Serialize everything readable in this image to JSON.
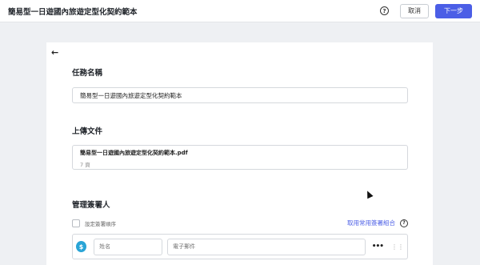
{
  "topbar": {
    "title": "簡易型一日遊國內旅遊定型化契約範本",
    "help_icon": "?",
    "cancel_label": "取消",
    "next_label": "下一步"
  },
  "content": {
    "back_icon": "←",
    "task_section_title": "任務名稱",
    "task_name_value": "簡易型一日遊國內旅遊定型化契約範本",
    "upload_section_title": "上傳文件",
    "file_name": "簡易型一日遊國內旅遊定型化契約範本.pdf",
    "file_pages": "7 頁",
    "signers_section_title": "管理簽署人",
    "order_checkbox_label": "設定簽署順序",
    "combo_link": "取用常用簽署組合",
    "combo_help_icon": "?",
    "signer": {
      "icon": "$",
      "name_placeholder": "姓名",
      "email_placeholder": "電子郵件",
      "more_icon": "•••",
      "drag_icon": "⋮⋮"
    }
  },
  "colors": {
    "accent": "#4b5ee6",
    "signer_icon": "#29a4d6",
    "background": "#eef0f3"
  }
}
